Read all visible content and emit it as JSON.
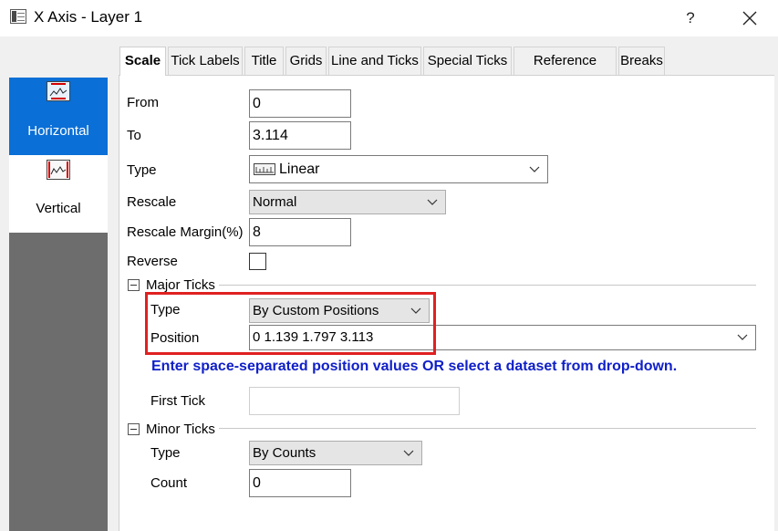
{
  "window": {
    "title": "X Axis - Layer 1",
    "help_label": "?",
    "close_icon": "close-icon"
  },
  "tabs": [
    {
      "label": "Scale",
      "active": true
    },
    {
      "label": "Tick Labels",
      "active": false
    },
    {
      "label": "Title",
      "active": false
    },
    {
      "label": "Grids",
      "active": false
    },
    {
      "label": "Line and Ticks",
      "active": false
    },
    {
      "label": "Special Ticks",
      "active": false
    },
    {
      "label": "Reference Lines",
      "active": false
    },
    {
      "label": "Breaks",
      "active": false
    }
  ],
  "sidebar": {
    "items": [
      {
        "label": "Horizontal",
        "icon": "horizontal-axis-icon",
        "selected": true
      },
      {
        "label": "Vertical",
        "icon": "vertical-axis-icon",
        "selected": false
      }
    ]
  },
  "scale": {
    "from_label": "From",
    "from_value": "0",
    "to_label": "To",
    "to_value": "3.114",
    "type_label": "Type",
    "type_value": "Linear",
    "rescale_label": "Rescale",
    "rescale_value": "Normal",
    "rescale_margin_label": "Rescale Margin(%)",
    "rescale_margin_value": "8",
    "reverse_label": "Reverse",
    "reverse_checked": false
  },
  "major_ticks": {
    "section_label": "Major Ticks",
    "type_label": "Type",
    "type_value": "By Custom Positions",
    "position_label": "Position",
    "position_value": "0 1.139 1.797 3.113",
    "hint": "Enter space-separated position values OR select a dataset from drop-down.",
    "first_tick_label": "First Tick",
    "first_tick_value": ""
  },
  "minor_ticks": {
    "section_label": "Minor Ticks",
    "type_label": "Type",
    "type_value": "By Counts",
    "count_label": "Count",
    "count_value": "0"
  },
  "colors": {
    "selected_sidebar": "#0a6fd6",
    "highlight_border": "#e02020",
    "hint_text": "#1020c8"
  }
}
